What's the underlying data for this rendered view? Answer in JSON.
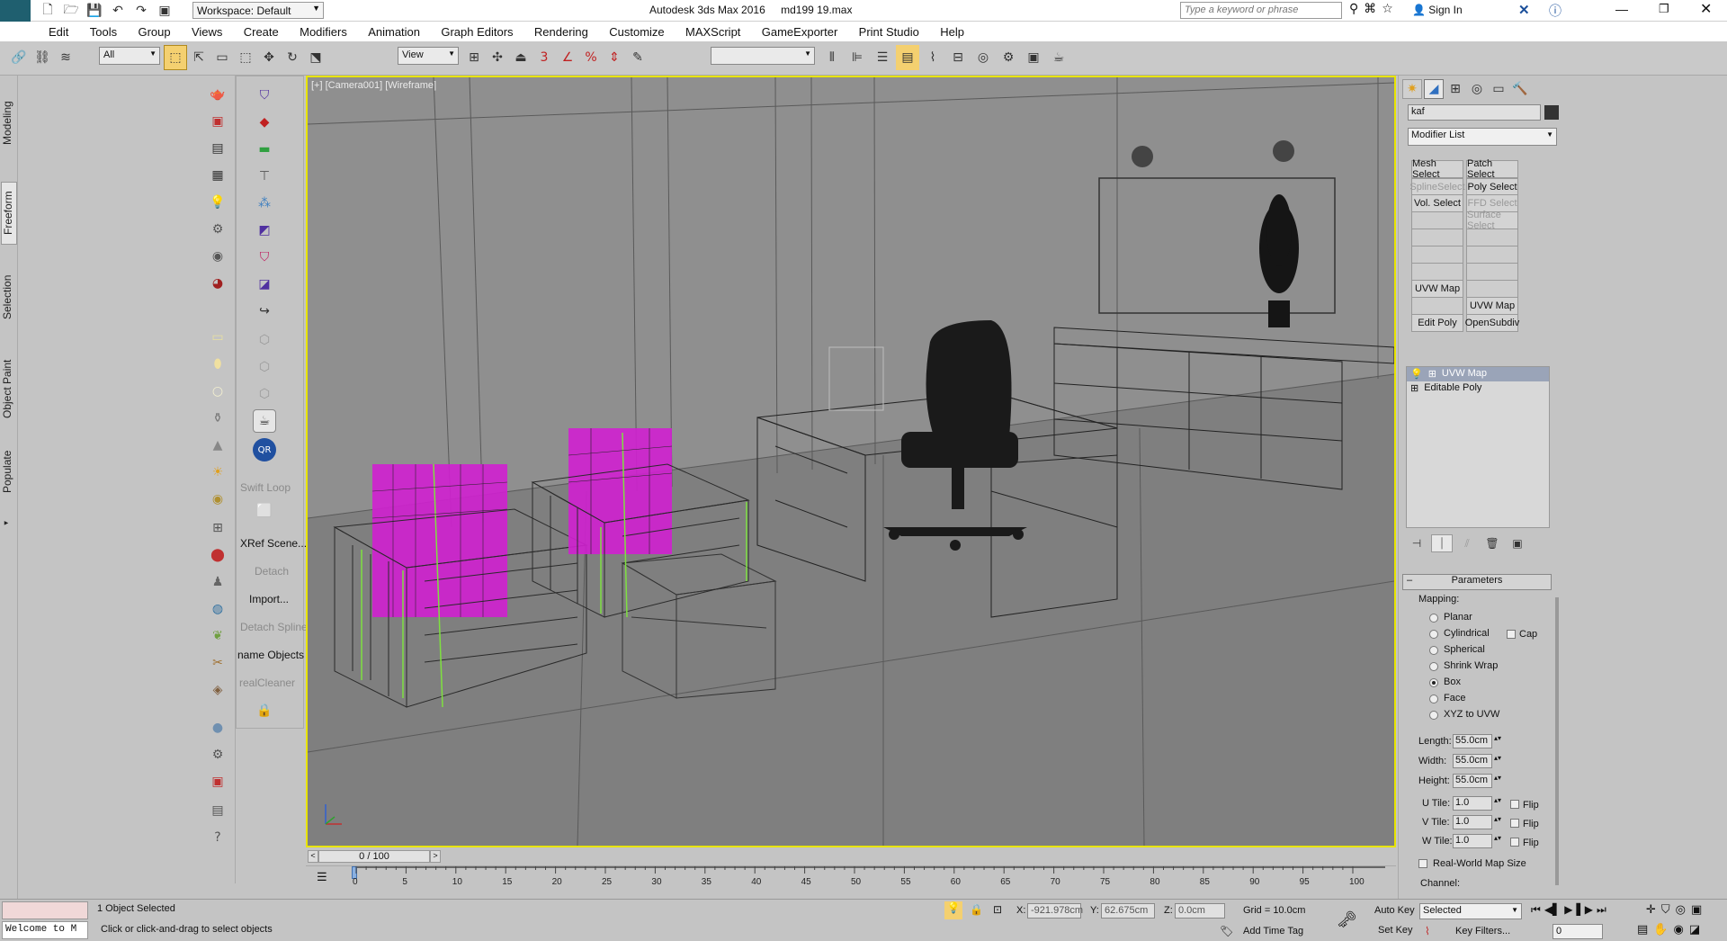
{
  "titlebar": {
    "workspace": "Workspace: Default",
    "app_title": "Autodesk 3ds Max 2016",
    "file_name": "md199 19.max",
    "search_placeholder": "Type a keyword or phrase",
    "sign_in": "Sign In"
  },
  "menu": [
    "Edit",
    "Tools",
    "Group",
    "Views",
    "Create",
    "Modifiers",
    "Animation",
    "Graph Editors",
    "Rendering",
    "Customize",
    "MAXScript",
    "GameExporter",
    "Print Studio",
    "Help"
  ],
  "toolbar": {
    "selection_filter": "All",
    "ref_coord": "View",
    "named_selection": ""
  },
  "ribbon_tabs": [
    "Modeling",
    "Freeform",
    "Selection",
    "Object Paint",
    "Populate"
  ],
  "tool_column": {
    "items": [
      "Swift Loop",
      "XRef Scene...",
      "Detach",
      "Import...",
      "Detach Spline",
      "name Objects",
      "realCleaner"
    ]
  },
  "viewport": {
    "label": "[+] [Camera001] [Wireframe]"
  },
  "timeslider": {
    "frame": "0 / 100"
  },
  "trackbar": {
    "ticks": [
      "0",
      "5",
      "10",
      "15",
      "20",
      "25",
      "30",
      "35",
      "40",
      "45",
      "50",
      "55",
      "60",
      "65",
      "70",
      "75",
      "80",
      "85",
      "90",
      "95",
      "100"
    ]
  },
  "command_panel": {
    "object_name": "kaf",
    "modifier_list": "Modifier List",
    "buttons": [
      [
        "Mesh Select",
        "Patch Select"
      ],
      [
        "SplineSelect",
        "Poly Select"
      ],
      [
        "Vol. Select",
        "FFD Select"
      ],
      [
        "",
        "Surface Select"
      ],
      [
        "",
        ""
      ],
      [
        "",
        ""
      ],
      [
        "",
        ""
      ],
      [
        "UVW Map",
        ""
      ],
      [
        "",
        "UVW Map"
      ],
      [
        "Edit Poly",
        "OpenSubdiv"
      ]
    ],
    "disabled_buttons": [
      "SplineSelect",
      "FFD Select",
      "Surface Select"
    ],
    "stack": [
      "UVW Map",
      "Editable Poly"
    ],
    "rollout_title": "Parameters",
    "mapping_label": "Mapping:",
    "mapping_options": [
      "Planar",
      "Cylindrical",
      "Spherical",
      "Shrink Wrap",
      "Box",
      "Face",
      "XYZ to UVW"
    ],
    "mapping_selected": "Box",
    "cap_label": "Cap",
    "length_label": "Length:",
    "length": "55.0cm",
    "width_label": "Width:",
    "width": "55.0cm",
    "height_label": "Height:",
    "height": "55.0cm",
    "utile_label": "U Tile:",
    "utile": "1.0",
    "vtile_label": "V Tile:",
    "vtile": "1.0",
    "wtile_label": "W Tile:",
    "wtile": "1.0",
    "flip_label": "Flip",
    "real_world": "Real-World Map Size",
    "channel_label": "Channel:"
  },
  "status": {
    "script_listener": "Welcome to M",
    "selected": "1 Object Selected",
    "prompt": "Click or click-and-drag to select objects",
    "x_label": "X:",
    "x": "-921.978cm",
    "y_label": "Y:",
    "y": "62.675cm",
    "z_label": "Z:",
    "z": "0.0cm",
    "grid": "Grid = 10.0cm",
    "add_time_tag": "Add Time Tag",
    "auto_key": "Auto Key",
    "set_key": "Set Key",
    "key_mode": "Selected",
    "key_filters": "Key Filters...",
    "current_frame": "0"
  },
  "colors": {
    "viewport_border": "#e8e400",
    "viewport_bg": "#8f8f8f",
    "wire_magenta": "#e020e0",
    "wire_green": "#7fe040",
    "wire_dark": "#222222"
  }
}
